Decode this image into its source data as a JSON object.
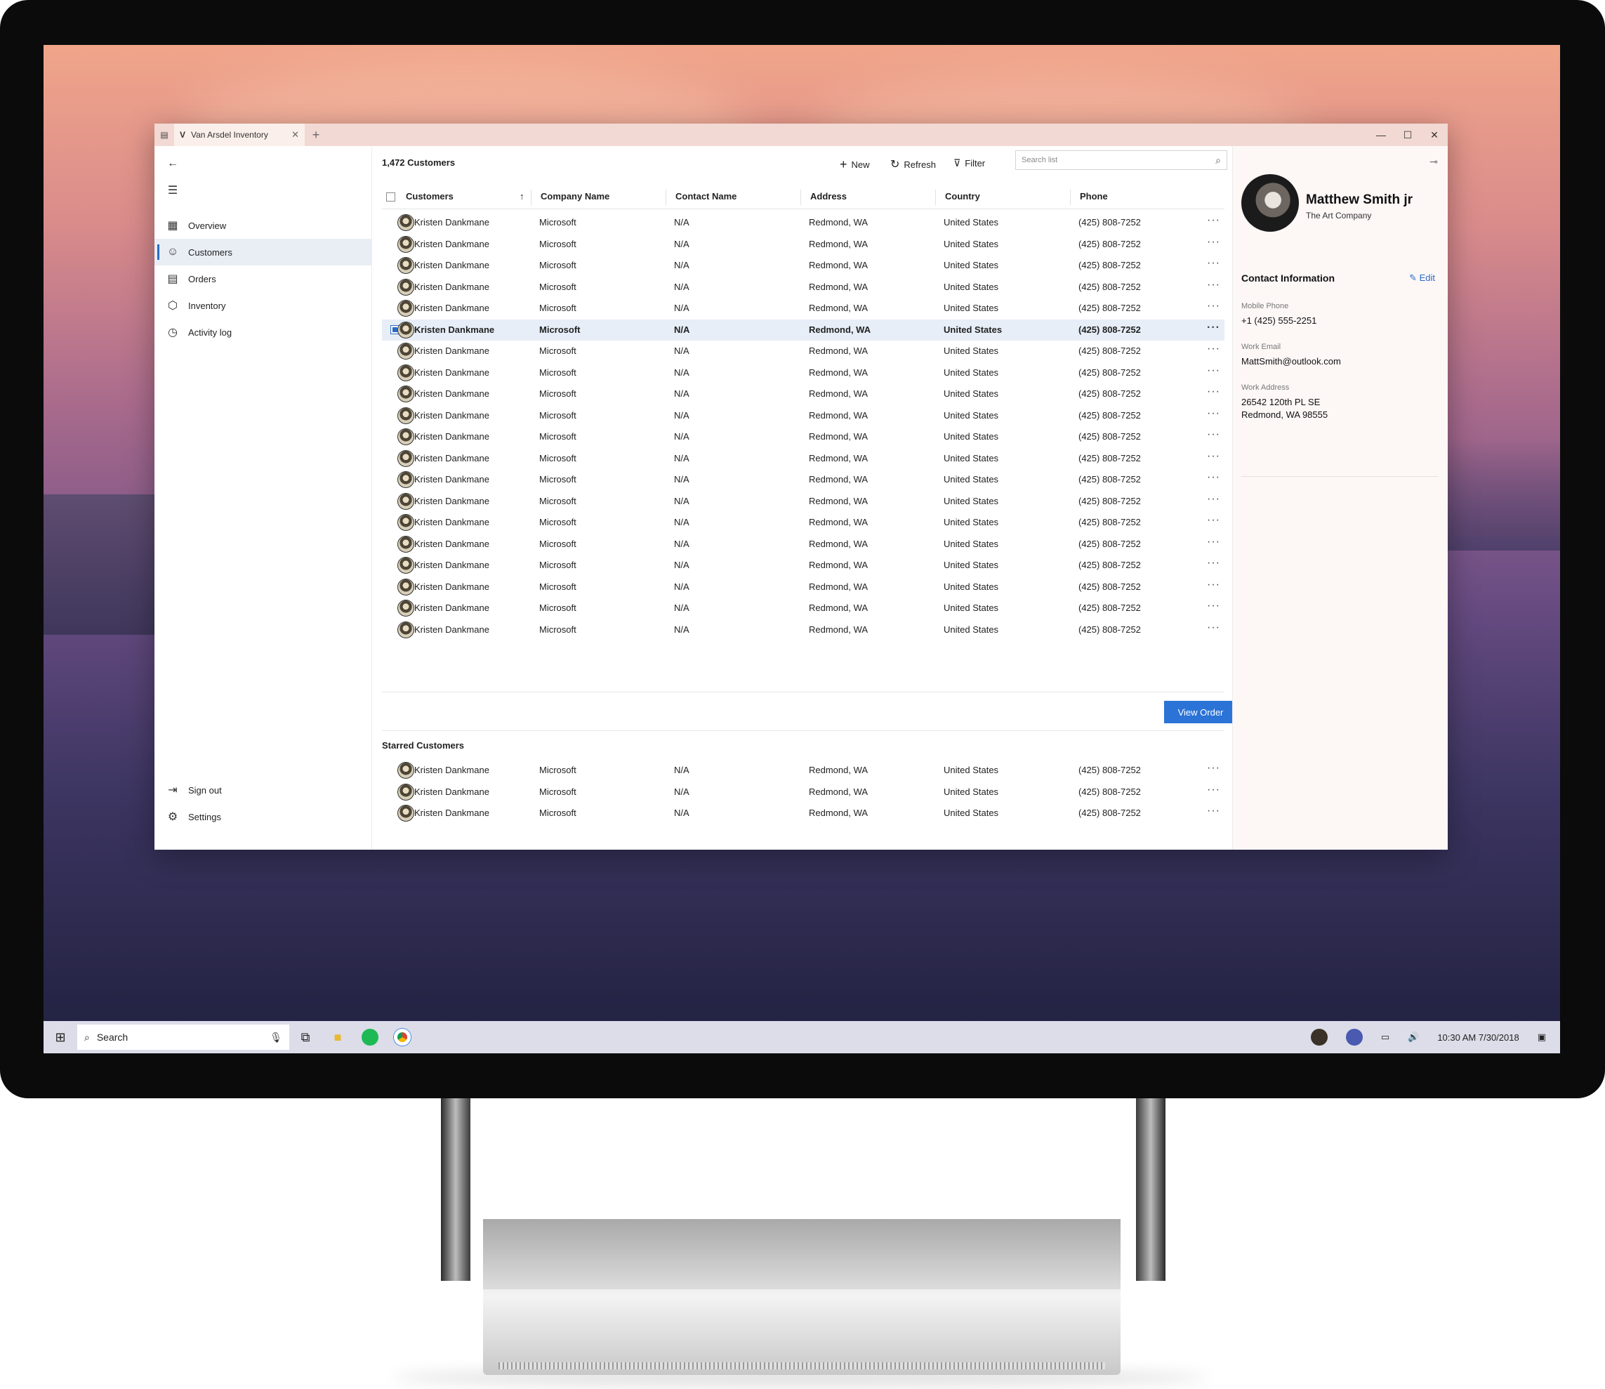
{
  "window": {
    "tab_title": "Van Arsdel Inventory",
    "tab_close": "✕",
    "new_tab": "+",
    "minimize": "—",
    "maximize": "☐",
    "close": "✕"
  },
  "nav": {
    "back": "←",
    "menu": "☰",
    "items": [
      {
        "label": "Overview",
        "icon": "dashboard-icon"
      },
      {
        "label": "Customers",
        "icon": "person-icon"
      },
      {
        "label": "Orders",
        "icon": "list-icon"
      },
      {
        "label": "Inventory",
        "icon": "box-icon"
      },
      {
        "label": "Activity log",
        "icon": "clock-icon"
      }
    ],
    "footer": [
      {
        "label": "Sign out",
        "icon": "sign-out-icon"
      },
      {
        "label": "Settings",
        "icon": "gear-icon"
      }
    ]
  },
  "toolbar": {
    "count": "1,472 Customers",
    "new_label": "New",
    "refresh_label": "Refresh",
    "filter_label": "Filter",
    "search_placeholder": "Search list"
  },
  "table": {
    "columns": [
      "Customers",
      "Company Name",
      "Contact Name",
      "Address",
      "Country",
      "Phone"
    ],
    "sort_indicator": "↑",
    "selected_index": 5,
    "rows": [
      [
        "Kristen Dankmane",
        "Microsoft",
        "N/A",
        "Redmond, WA",
        "United States",
        "(425) 808-7252"
      ],
      [
        "Kristen Dankmane",
        "Microsoft",
        "N/A",
        "Redmond, WA",
        "United States",
        "(425) 808-7252"
      ],
      [
        "Kristen Dankmane",
        "Microsoft",
        "N/A",
        "Redmond, WA",
        "United States",
        "(425) 808-7252"
      ],
      [
        "Kristen Dankmane",
        "Microsoft",
        "N/A",
        "Redmond, WA",
        "United States",
        "(425) 808-7252"
      ],
      [
        "Kristen Dankmane",
        "Microsoft",
        "N/A",
        "Redmond, WA",
        "United States",
        "(425) 808-7252"
      ],
      [
        "Kristen Dankmane",
        "Microsoft",
        "N/A",
        "Redmond, WA",
        "United States",
        "(425) 808-7252"
      ],
      [
        "Kristen Dankmane",
        "Microsoft",
        "N/A",
        "Redmond, WA",
        "United States",
        "(425) 808-7252"
      ],
      [
        "Kristen Dankmane",
        "Microsoft",
        "N/A",
        "Redmond, WA",
        "United States",
        "(425) 808-7252"
      ],
      [
        "Kristen Dankmane",
        "Microsoft",
        "N/A",
        "Redmond, WA",
        "United States",
        "(425) 808-7252"
      ],
      [
        "Kristen Dankmane",
        "Microsoft",
        "N/A",
        "Redmond, WA",
        "United States",
        "(425) 808-7252"
      ],
      [
        "Kristen Dankmane",
        "Microsoft",
        "N/A",
        "Redmond, WA",
        "United States",
        "(425) 808-7252"
      ],
      [
        "Kristen Dankmane",
        "Microsoft",
        "N/A",
        "Redmond, WA",
        "United States",
        "(425) 808-7252"
      ],
      [
        "Kristen Dankmane",
        "Microsoft",
        "N/A",
        "Redmond, WA",
        "United States",
        "(425) 808-7252"
      ],
      [
        "Kristen Dankmane",
        "Microsoft",
        "N/A",
        "Redmond, WA",
        "United States",
        "(425) 808-7252"
      ],
      [
        "Kristen Dankmane",
        "Microsoft",
        "N/A",
        "Redmond, WA",
        "United States",
        "(425) 808-7252"
      ],
      [
        "Kristen Dankmane",
        "Microsoft",
        "N/A",
        "Redmond, WA",
        "United States",
        "(425) 808-7252"
      ],
      [
        "Kristen Dankmane",
        "Microsoft",
        "N/A",
        "Redmond, WA",
        "United States",
        "(425) 808-7252"
      ],
      [
        "Kristen Dankmane",
        "Microsoft",
        "N/A",
        "Redmond, WA",
        "United States",
        "(425) 808-7252"
      ],
      [
        "Kristen Dankmane",
        "Microsoft",
        "N/A",
        "Redmond, WA",
        "United States",
        "(425) 808-7252"
      ],
      [
        "Kristen Dankmane",
        "Microsoft",
        "N/A",
        "Redmond, WA",
        "United States",
        "(425) 808-7252"
      ]
    ],
    "more": "···",
    "view_order": "View Order"
  },
  "starred": {
    "title": "Starred Customers",
    "rows": [
      [
        "Kristen Dankmane",
        "Microsoft",
        "N/A",
        "Redmond, WA",
        "United States",
        "(425) 808-7252"
      ],
      [
        "Kristen Dankmane",
        "Microsoft",
        "N/A",
        "Redmond, WA",
        "United States",
        "(425) 808-7252"
      ],
      [
        "Kristen Dankmane",
        "Microsoft",
        "N/A",
        "Redmond, WA",
        "United States",
        "(425) 808-7252"
      ]
    ]
  },
  "detail": {
    "name": "Matthew Smith jr",
    "company": "The Art Company",
    "section": "Contact Information",
    "edit": "Edit",
    "mobile_label": "Mobile Phone",
    "mobile": "+1 (425) 555-2251",
    "email_label": "Work Email",
    "email": "MattSmith@outlook.com",
    "address_label": "Work Address",
    "address_line1": "26542 120th PL SE",
    "address_line2": "Redmond, WA 98555"
  },
  "taskbar": {
    "search": "Search",
    "clock": "10:30 AM 7/30/2018"
  },
  "colors": {
    "accent": "#2b73d6",
    "selected_row": "#e7eef7",
    "titlebar": "#f2d9d3"
  }
}
